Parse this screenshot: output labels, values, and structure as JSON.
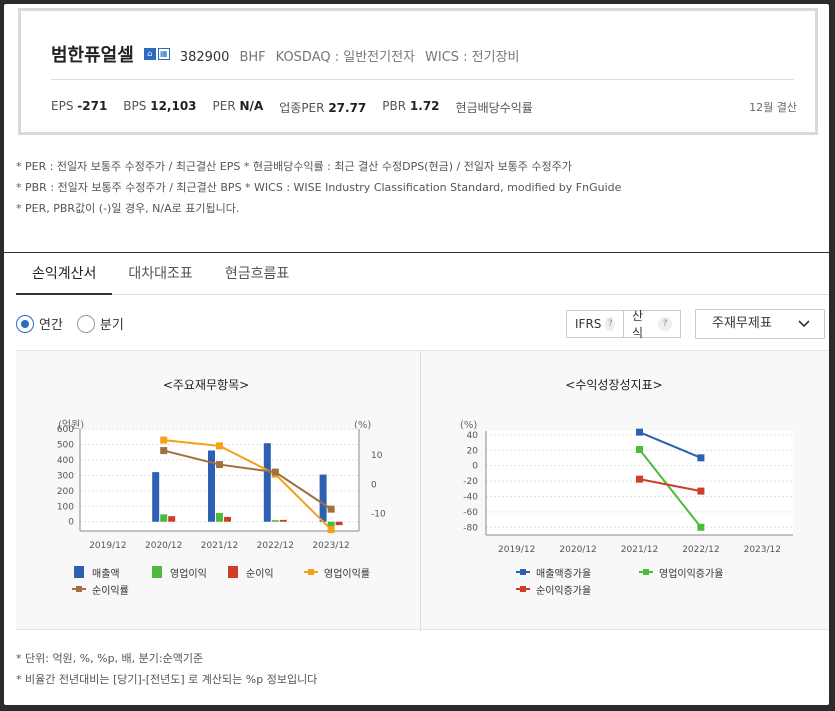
{
  "company": {
    "name": "범한퓨얼셀",
    "icons": [
      "home-icon",
      "building-icon"
    ],
    "code": "382900",
    "eng": "BHF",
    "market": "KOSDAQ : 일반전기전자",
    "wics": "WICS : 전기장비"
  },
  "metrics": {
    "eps_label": "EPS",
    "eps": "-271",
    "bps_label": "BPS",
    "bps": "12,103",
    "per_label": "PER",
    "per": "N/A",
    "iper_label": "업종PER",
    "iper": "27.77",
    "pbr_label": "PBR",
    "pbr": "1.72",
    "div_label": "현금배당수익률",
    "fiscal": "12월 결산"
  },
  "notes": [
    "* PER : 전일자 보통주 수정주가 / 최근결산 EPS * 현금배당수익률 : 최근 결산 수정DPS(현금) / 전일자 보통주 수정주가",
    "* PBR : 전일자 보통주 수정주가 / 최근결산 BPS * WICS : WISE Industry Classification Standard, modified by FnGuide",
    "* PER, PBR값이 (-)일 경우, N/A로 표기됩니다."
  ],
  "tabs": [
    "손익계산서",
    "대차대조표",
    "현금흐름표"
  ],
  "period": {
    "annual": "연간",
    "quarter": "분기"
  },
  "options": {
    "ifrs": "IFRS",
    "calc": "산식",
    "help": "?",
    "select": "주재무제표"
  },
  "bottom_notes": [
    "* 단위: 억원, %, %p, 배, 분기:순액기준",
    "* 비율간 전년대비는 [당기]-[전년도] 로 계산되는 %p 정보입니다"
  ],
  "colors": {
    "revenue": "#2d5fb4",
    "op_income": "#4cbb3c",
    "net_income": "#d03c2a",
    "op_margin": "#f6a01a",
    "net_margin": "#a07040"
  },
  "chart_data": [
    {
      "type": "bar",
      "title": "<주요재무항목>",
      "ylabel": "(억원)",
      "y2label": "(%)",
      "categories": [
        "2019/12",
        "2020/12",
        "2021/12",
        "2022/12",
        "2023/12"
      ],
      "ylim": [
        -60,
        600
      ],
      "yticks": [
        0,
        100,
        200,
        300,
        400,
        500,
        600
      ],
      "y2lim": [
        -16,
        19
      ],
      "y2ticks": [
        -10,
        0,
        10
      ],
      "series": [
        {
          "name": "매출액",
          "kind": "bar",
          "values": [
            null,
            321,
            461,
            508,
            305
          ]
        },
        {
          "name": "영업이익",
          "kind": "bar",
          "values": [
            null,
            48,
            57,
            10,
            -35
          ]
        },
        {
          "name": "순이익",
          "kind": "bar",
          "values": [
            null,
            36,
            31,
            12,
            -22
          ]
        },
        {
          "name": "영업이익률",
          "kind": "line",
          "axis": "right",
          "values": [
            null,
            15.2,
            13.2,
            3.5,
            -15.5
          ]
        },
        {
          "name": "순이익률",
          "kind": "line",
          "axis": "right",
          "values": [
            null,
            11.6,
            6.8,
            4.2,
            -8.5
          ]
        }
      ],
      "legend": "bottom"
    },
    {
      "type": "line",
      "title": "<수익성장성지표>",
      "ylabel": "(%)",
      "categories": [
        "2019/12",
        "2020/12",
        "2021/12",
        "2022/12",
        "2023/12"
      ],
      "ylim": [
        -90,
        45
      ],
      "yticks": [
        -80,
        -60,
        -40,
        -20,
        0,
        20,
        40
      ],
      "series": [
        {
          "name": "매출액증가율",
          "values": [
            null,
            null,
            43.5,
            10.2,
            null
          ]
        },
        {
          "name": "영업이익증가율",
          "values": [
            null,
            null,
            21,
            -80,
            null
          ]
        },
        {
          "name": "순이익증가율",
          "values": [
            null,
            null,
            -17.5,
            -33,
            null
          ]
        }
      ],
      "legend": "bottom"
    }
  ]
}
